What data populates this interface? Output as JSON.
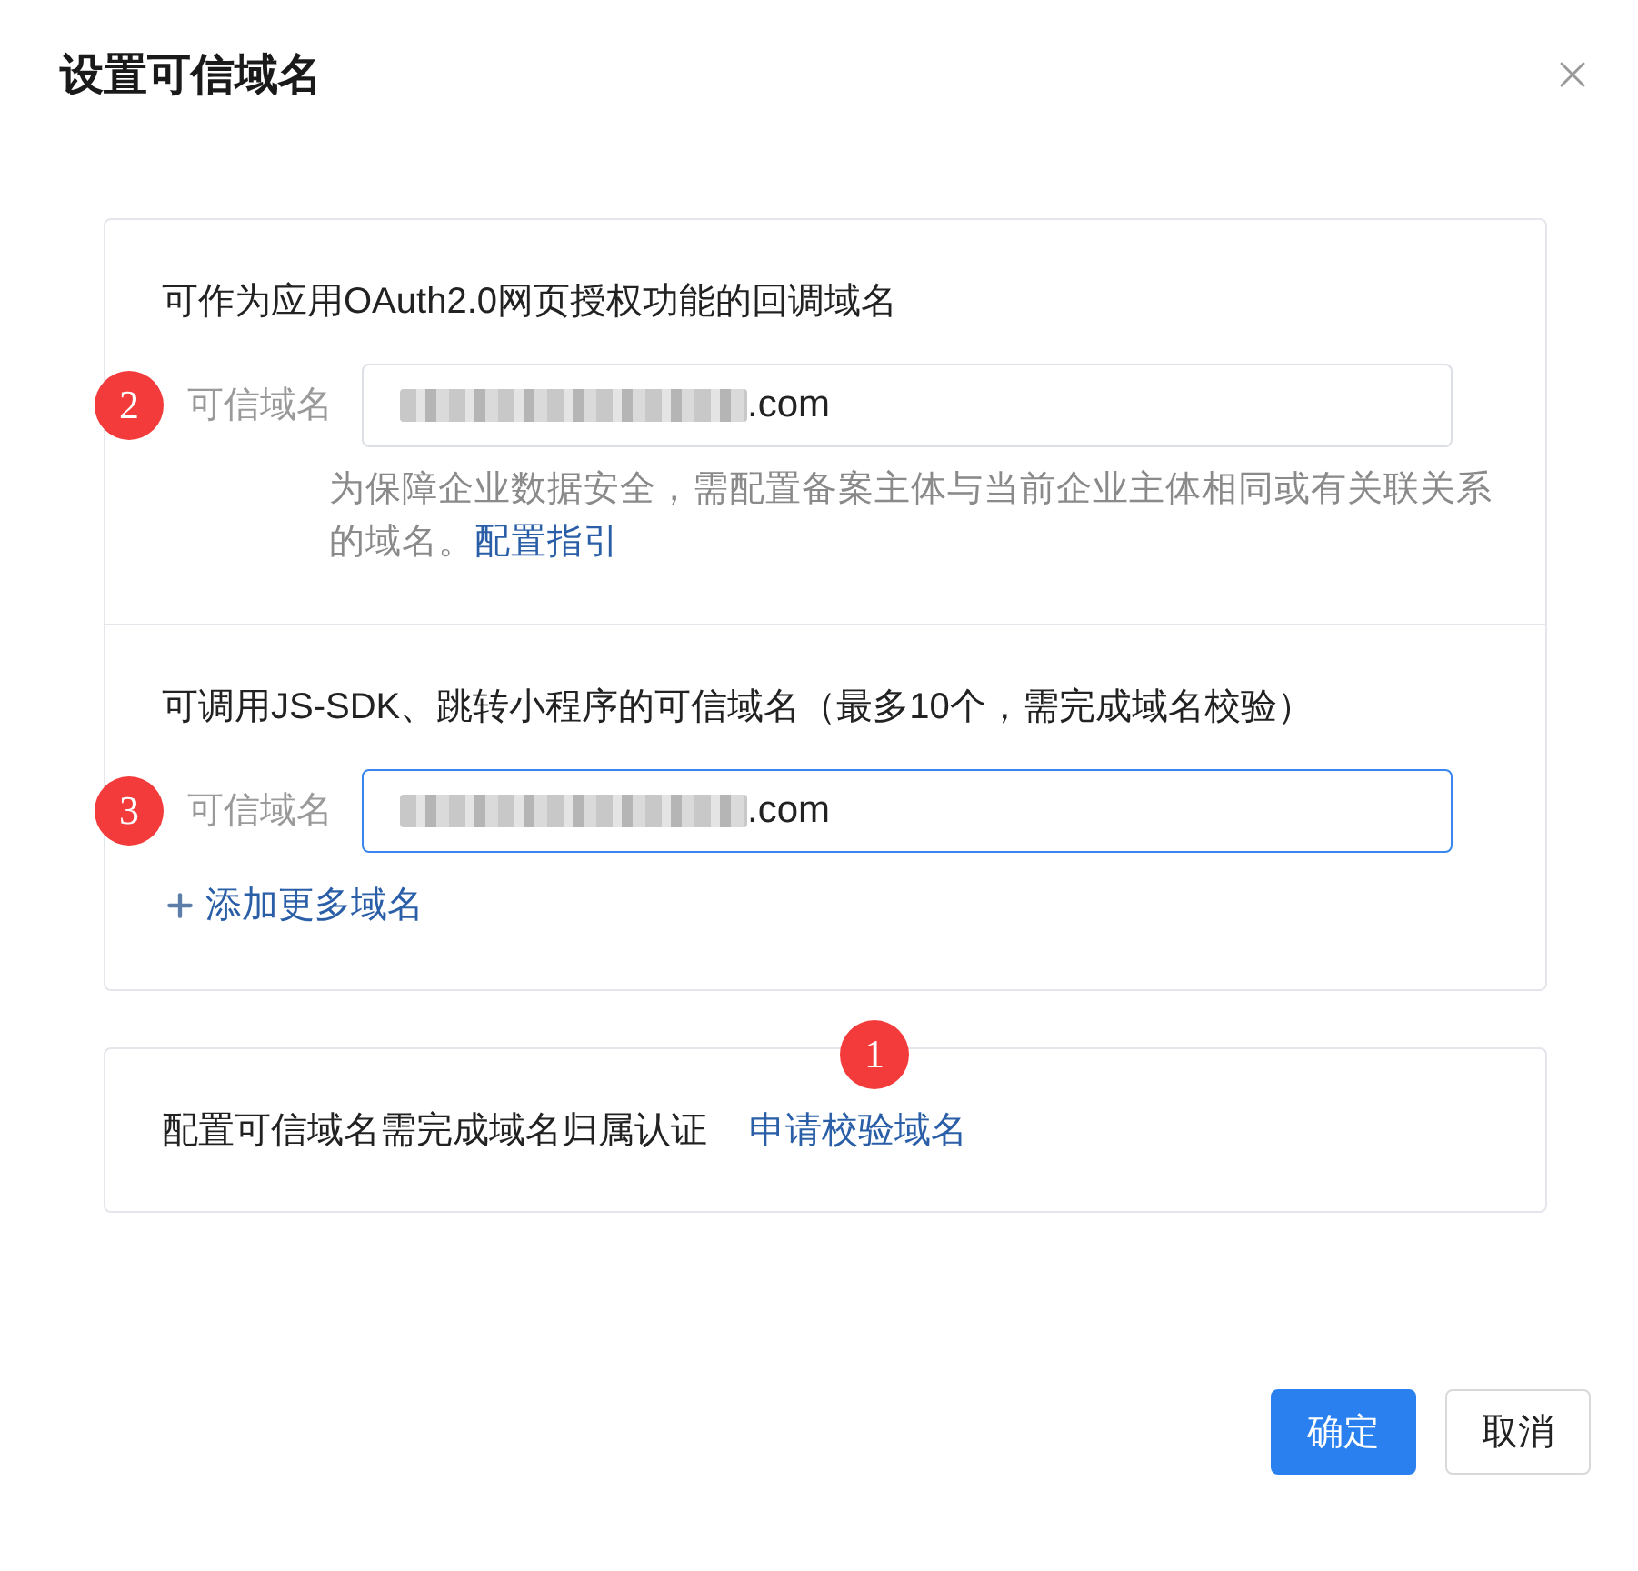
{
  "dialog": {
    "title": "设置可信域名"
  },
  "sections": [
    {
      "heading": "可作为应用OAuth2.0网页授权功能的回调域名",
      "marker": "2",
      "field": {
        "label": "可信域名",
        "value": ".com",
        "redacted": true,
        "focused": false
      },
      "help": "为保障企业数据安全，需配置备案主体与当前企业主体相同或有关联关系的域名。",
      "help_link": "配置指引"
    },
    {
      "heading": "可调用JS-SDK、跳转小程序的可信域名（最多10个，需完成域名校验）",
      "marker": "3",
      "field": {
        "label": "可信域名",
        "value": ".com",
        "redacted": true,
        "focused": true
      },
      "add_link": "添加更多域名"
    }
  ],
  "verification": {
    "text": "配置可信域名需完成域名归属认证",
    "link": "申请校验域名",
    "marker": "1"
  },
  "buttons": [
    {
      "label": "确定",
      "kind": "primary"
    },
    {
      "label": "取消",
      "kind": "default"
    }
  ]
}
